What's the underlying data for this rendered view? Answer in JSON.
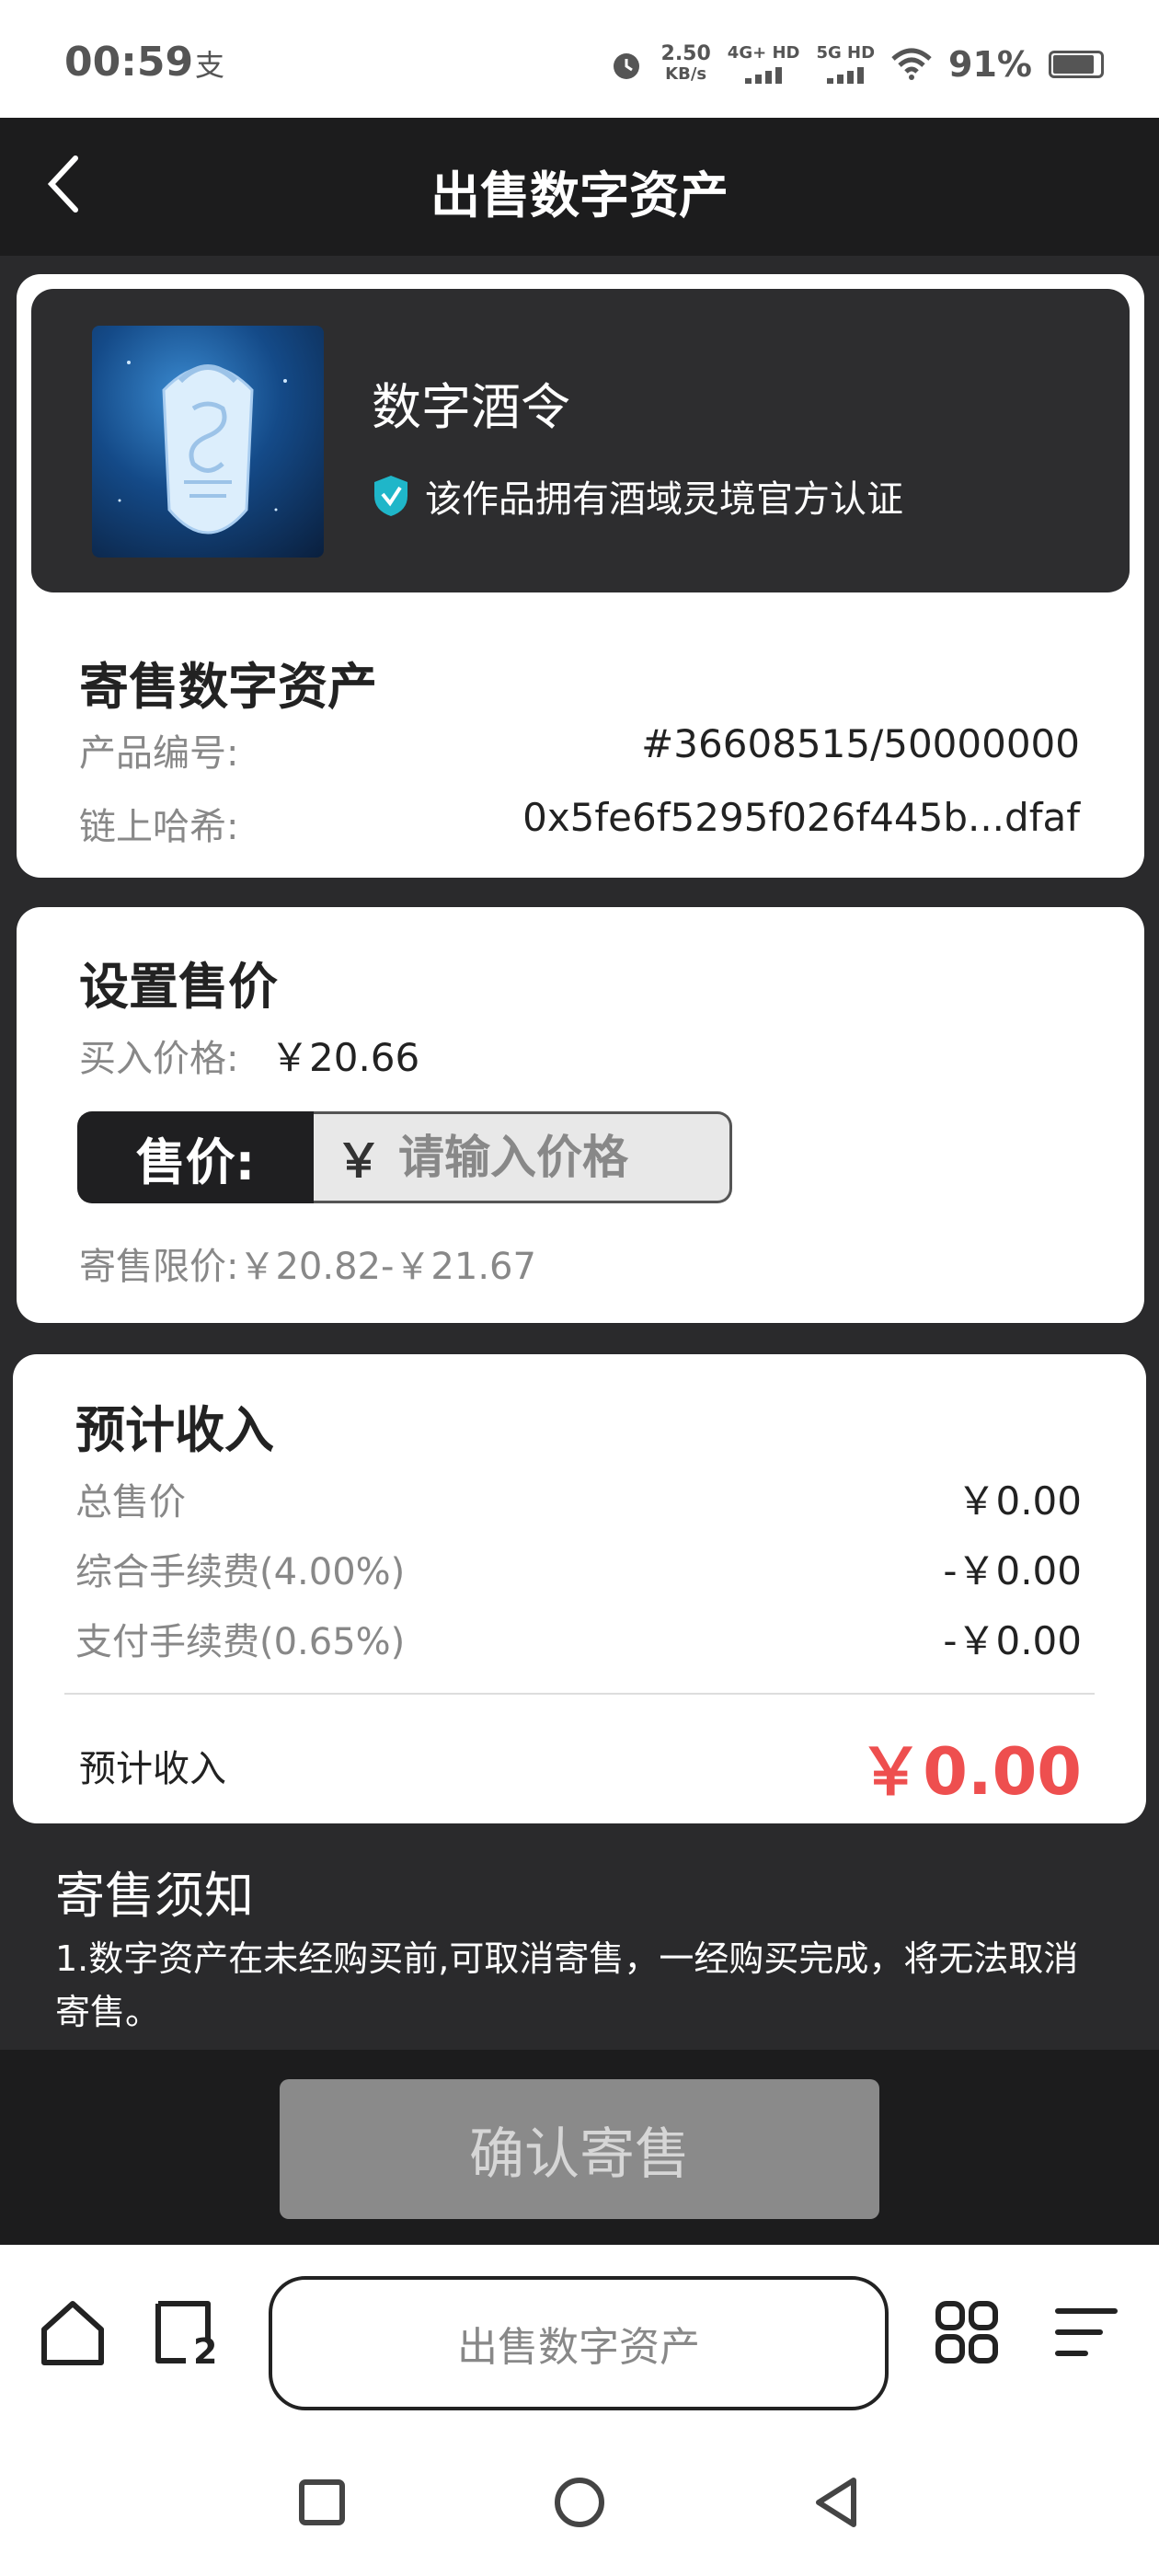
{
  "status_bar": {
    "time": "00:59",
    "notification_icon": "alipay-icon",
    "speed_value": "2.50",
    "speed_unit": "KB/s",
    "signal1_label": "4G+ HD",
    "signal2_label": "5G HD",
    "battery_percent": "91%"
  },
  "header": {
    "title": "出售数字资产"
  },
  "asset": {
    "name": "数字酒令",
    "verification_text": "该作品拥有酒域灵境官方认证"
  },
  "consign": {
    "section_title": "寄售数字资产",
    "product_no_label": "产品编号:",
    "product_no_value": "#36608515/50000000",
    "hash_label": "链上哈希:",
    "hash_value": "0x5fe6f5295f026f445b...dfaf"
  },
  "pricing": {
    "section_title": "设置售价",
    "buy_price_label": "买入价格:",
    "buy_price_value": "￥20.66",
    "sell_label": "售价:",
    "currency_symbol": "￥",
    "input_placeholder": "请输入价格",
    "input_value": "",
    "limit_text": "寄售限价:￥20.82-￥21.67"
  },
  "income": {
    "section_title": "预计收入",
    "rows": [
      {
        "label": "总售价",
        "value": "￥0.00"
      },
      {
        "label": "综合手续费(4.00%)",
        "value": "-￥0.00"
      },
      {
        "label": "支付手续费(0.65%)",
        "value": "-￥0.00"
      }
    ],
    "total_label": "预计收入",
    "total_value": "￥0.00"
  },
  "notice": {
    "title": "寄售须知",
    "text": "1.数字资产在未经购买前,可取消寄售，一经购买完成，将无法取消寄售。"
  },
  "actions": {
    "confirm_label": "确认寄售"
  },
  "browser": {
    "address_text": "出售数字资产",
    "tab_count": "2"
  },
  "colors": {
    "accent_red": "#ee4f4f",
    "dark_bg": "#2a2a2c",
    "verify_teal": "#1fb6c9"
  }
}
